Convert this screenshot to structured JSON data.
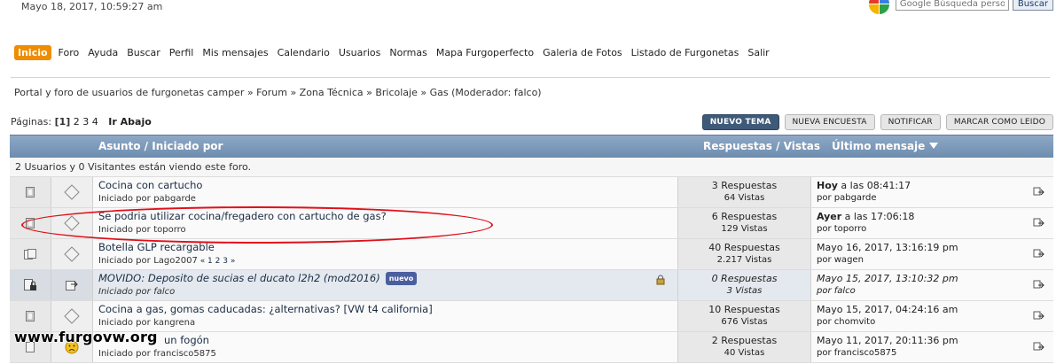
{
  "header": {
    "datetime": "Mayo 18, 2017, 10:59:27 am",
    "search_placeholder": "Google Búsqueda personal",
    "search_button": "Buscar"
  },
  "nav": [
    "Inicio",
    "Foro",
    "Ayuda",
    "Buscar",
    "Perfil",
    "Mis mensajes",
    "Calendario",
    "Usuarios",
    "Normas",
    "Mapa Furgoperfecto",
    "Galeria de Fotos",
    "Listado de Furgonetas",
    "Salir"
  ],
  "breadcrumb": "Portal y foro de usuarios de furgonetas camper » Forum » Zona Técnica » Bricolaje » Gas (Moderador: falco)",
  "pagination": {
    "label": "Páginas:",
    "current": "[1]",
    "others": "2 3 4",
    "jump": "Ir Abajo"
  },
  "buttons": {
    "new_topic": "NUEVO TEMA",
    "new_poll": "NUEVA ENCUESTA",
    "notify": "NOTIFICAR",
    "mark_read": "MARCAR COMO LEIDO"
  },
  "table": {
    "col_subject": "Asunto / Iniciado por",
    "col_replies": "Respuestas / Vistas",
    "col_last": "Último mensaje",
    "viewers": "2 Usuarios y 0 Visitantes están viendo este foro.",
    "rows": [
      {
        "title": "Cocina con cartucho",
        "by_label": "Iniciado por",
        "author": "pabgarde",
        "pages": "",
        "replies": "3 Respuestas",
        "views": "64 Vistas",
        "last_date_bold": "Hoy",
        "last_date": " a las 08:41:17",
        "last_by": "por pabgarde",
        "new": ""
      },
      {
        "title": "Se podria utilizar cocina/fregadero con cartucho de gas?",
        "by_label": "Iniciado por",
        "author": "toporro",
        "pages": "",
        "replies": "6 Respuestas",
        "views": "129 Vistas",
        "last_date_bold": "Ayer",
        "last_date": " a las 17:06:18",
        "last_by": "por toporro",
        "new": ""
      },
      {
        "title": "Botella GLP recargable",
        "by_label": "Iniciado por",
        "author": "Lago2007",
        "pages": " « 1 2 3 »",
        "replies": "40 Respuestas",
        "views": "2.217 Vistas",
        "last_date_bold": "",
        "last_date": "Mayo 16, 2017, 13:16:19 pm",
        "last_by": "por wagen",
        "new": ""
      },
      {
        "title": "MOVIDO: Deposito de sucias el ducato l2h2 (mod2016)",
        "by_label": "Iniciado por",
        "author": "falco",
        "pages": "",
        "replies": "0 Respuestas",
        "views": "3 Vistas",
        "last_date_bold": "",
        "last_date": "Mayo 15, 2017, 13:10:32 pm",
        "last_by": "por falco",
        "new": "nuevo"
      },
      {
        "title": "Cocina a gas, gomas caducadas: ¿alternativas? [VW t4 california]",
        "by_label": "Iniciado por",
        "author": "kangrena",
        "pages": "",
        "replies": "10 Respuestas",
        "views": "676 Vistas",
        "last_date_bold": "",
        "last_date": "Mayo 15, 2017, 04:24:16 am",
        "last_by": "por chomvito",
        "new": ""
      },
      {
        "title": "un fogón",
        "by_label": "Iniciado por",
        "author": "francisco5875",
        "pages": "",
        "replies": "2 Respuestas",
        "views": "40 Vistas",
        "last_date_bold": "",
        "last_date": "Mayo 11, 2017, 20:11:36 pm",
        "last_by": "por francisco5875",
        "new": ""
      }
    ]
  },
  "watermark": "www.furgovw.org",
  "colors": {
    "nav_active": "#f08c00",
    "header_bar": "#7a97b8",
    "highlight_oval": "#e0101a"
  }
}
